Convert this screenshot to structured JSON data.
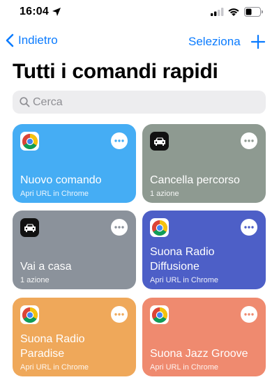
{
  "status_bar": {
    "time": "16:04"
  },
  "nav": {
    "back_label": "Indietro",
    "select_label": "Seleziona"
  },
  "page": {
    "title": "Tutti i comandi rapidi"
  },
  "search": {
    "placeholder": "Cerca"
  },
  "shortcuts": [
    {
      "title": "Nuovo comando",
      "subtitle": "Apri URL in Chrome",
      "icon": "chrome-icon",
      "color": "#45adf4"
    },
    {
      "title": "Cancella percorso",
      "subtitle": "1 azione",
      "icon": "car-icon",
      "color": "#8e9a91"
    },
    {
      "title": "Vai a casa",
      "subtitle": "1 azione",
      "icon": "car-icon",
      "color": "#8b929b"
    },
    {
      "title": "Suona Radio Diffusione",
      "subtitle": "Apri URL in Chrome",
      "icon": "chrome-icon",
      "color": "#4d5fc7"
    },
    {
      "title": "Suona Radio Paradise",
      "subtitle": "Apri URL in Chrome",
      "icon": "chrome-icon",
      "color": "#efa85a"
    },
    {
      "title": "Suona Jazz Groove",
      "subtitle": "Apri URL in Chrome",
      "icon": "chrome-icon",
      "color": "#ef8a6f"
    }
  ],
  "colors": {
    "accent": "#0a7bff"
  }
}
